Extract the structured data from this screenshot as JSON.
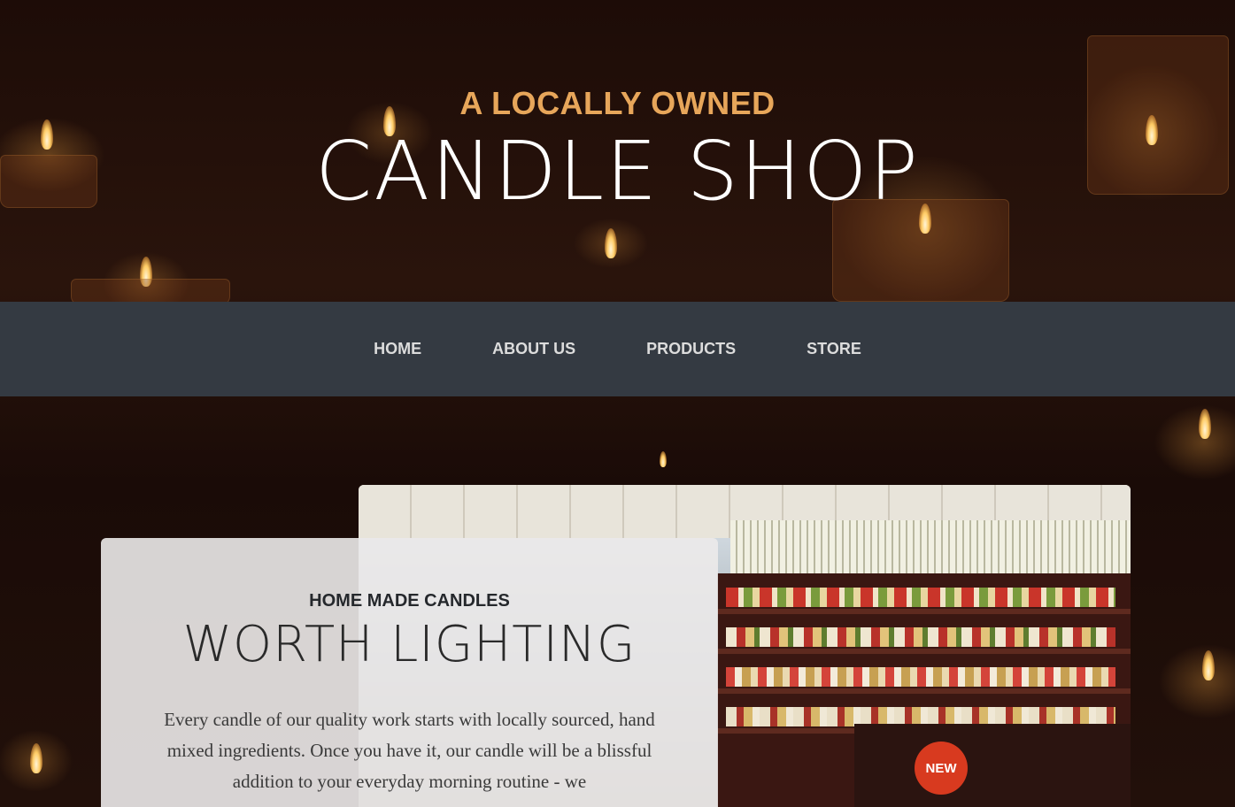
{
  "hero": {
    "kicker": "A LOCALLY OWNED",
    "title": "CANDLE SHOP"
  },
  "nav": {
    "items": [
      {
        "label": "HOME"
      },
      {
        "label": "ABOUT US"
      },
      {
        "label": "PRODUCTS"
      },
      {
        "label": "STORE"
      }
    ]
  },
  "intro": {
    "kicker": "HOME MADE CANDLES",
    "title": "WORTH LIGHTING",
    "text": "Every candle of our quality work starts with locally sourced, hand mixed ingredients. Once you have it, our candle will be a blissful addition to your everyday morning routine - we"
  },
  "photo": {
    "sign_text": "NEW"
  },
  "colors": {
    "accent": "#e7a65a",
    "nav_bg": "#343a42",
    "nav_text": "#dcdcdc",
    "page_bg": "#1c0d08"
  }
}
